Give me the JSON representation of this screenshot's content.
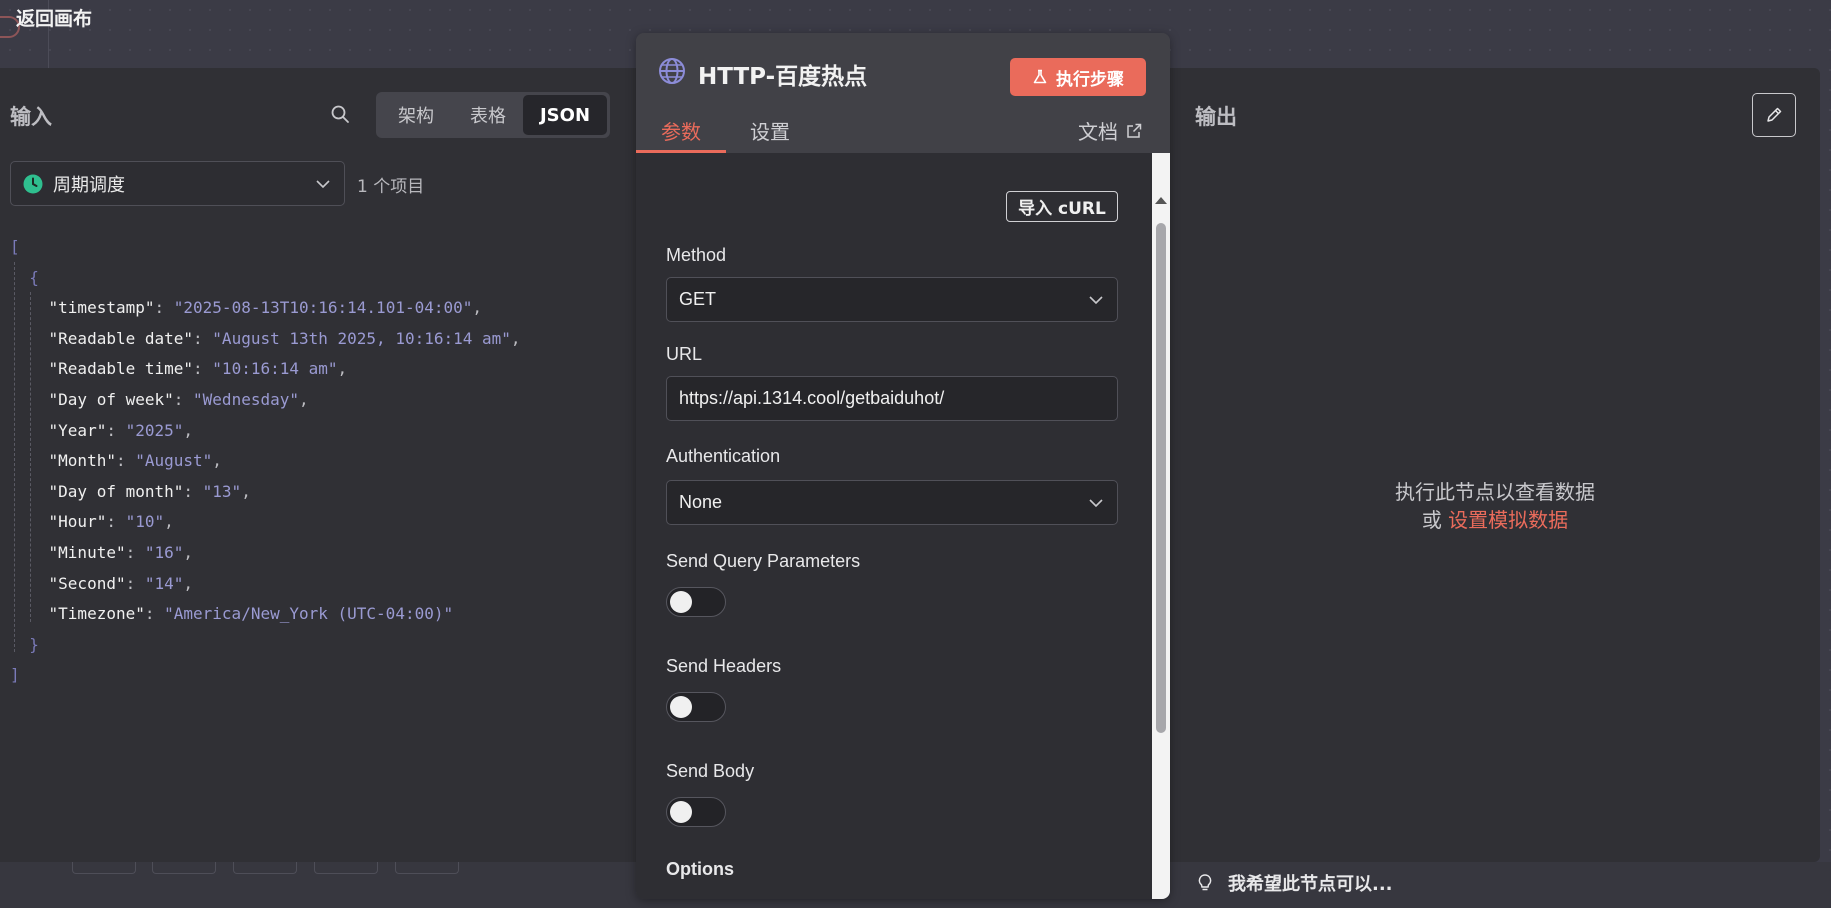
{
  "app": {
    "back_label": "返回画布"
  },
  "input_panel": {
    "title": "输入",
    "view_modes": [
      "架构",
      "表格",
      "JSON"
    ],
    "active_view": "JSON",
    "trigger_node": "周期调度",
    "item_count": "1 个项目",
    "json_lines": [
      {
        "k": "timestamp",
        "v": "2025-08-13T10:16:14.101-04:00"
      },
      {
        "k": "Readable date",
        "v": "August 13th 2025, 10:16:14 am"
      },
      {
        "k": "Readable time",
        "v": "10:16:14 am"
      },
      {
        "k": "Day of week",
        "v": "Wednesday"
      },
      {
        "k": "Year",
        "v": "2025"
      },
      {
        "k": "Month",
        "v": "August"
      },
      {
        "k": "Day of month",
        "v": "13"
      },
      {
        "k": "Hour",
        "v": "10"
      },
      {
        "k": "Minute",
        "v": "16"
      },
      {
        "k": "Second",
        "v": "14"
      },
      {
        "k": "Timezone",
        "v": "America/New_York (UTC-04:00)"
      }
    ]
  },
  "node": {
    "title": "HTTP-百度热点",
    "execute_label": "执行步骤",
    "tabs": [
      "参数",
      "设置"
    ],
    "active_tab": "参数",
    "docs_label": "文档",
    "import_curl_label": "导入 cURL",
    "fields": {
      "method_label": "Method",
      "method_value": "GET",
      "url_label": "URL",
      "url_value": "https://api.1314.cool/getbaiduhot/",
      "auth_label": "Authentication",
      "auth_value": "None",
      "send_query_label": "Send Query Parameters",
      "send_query_on": false,
      "send_headers_label": "Send Headers",
      "send_headers_on": false,
      "send_body_label": "Send Body",
      "send_body_on": false,
      "options_label": "Options"
    }
  },
  "output_panel": {
    "title": "输出",
    "empty_line1": "执行此节点以查看数据",
    "empty_prefix": "或",
    "empty_link": "设置模拟数据"
  },
  "footer": {
    "hint": "我希望此节点可以..."
  },
  "colors": {
    "accent": "#ea6b5b",
    "json_value": "#9a9ad2",
    "trigger_green": "#2fbf8f"
  }
}
